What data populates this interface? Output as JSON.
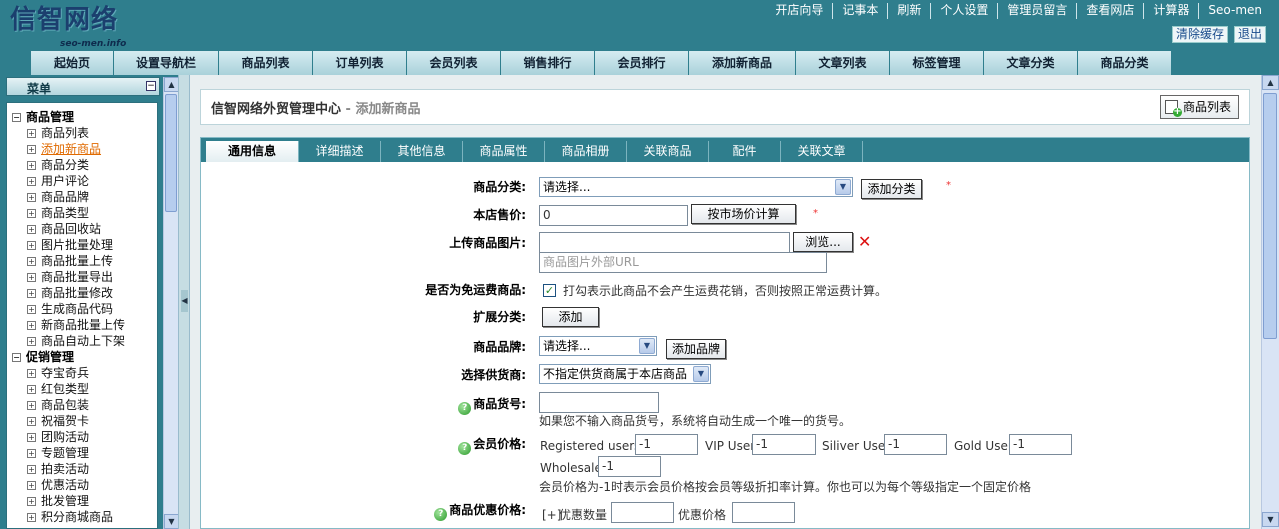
{
  "header": {
    "logo_text": "信智网络",
    "logo_sub": "seo-men.info",
    "top_links": [
      "开店向导",
      "记事本",
      "刷新",
      "个人设置",
      "管理员留言",
      "查看网店",
      "计算器",
      "Seo-men"
    ],
    "clear_cache": "清除缓存",
    "logout": "退出"
  },
  "nav": {
    "tabs": [
      "起始页",
      "设置导航栏",
      "商品列表",
      "订单列表",
      "会员列表",
      "销售排行",
      "会员排行",
      "添加新商品",
      "文章列表",
      "标签管理",
      "文章分类",
      "商品分类"
    ]
  },
  "sidebar": {
    "title": "菜单",
    "group1": "商品管理",
    "items1": [
      "商品列表",
      "添加新商品",
      "商品分类",
      "用户评论",
      "商品品牌",
      "商品类型",
      "商品回收站",
      "图片批量处理",
      "商品批量上传",
      "商品批量导出",
      "商品批量修改",
      "生成商品代码",
      "新商品批量上传",
      "商品自动上下架"
    ],
    "group2": "促销管理",
    "items2": [
      "夺宝奇兵",
      "红包类型",
      "商品包装",
      "祝福贺卡",
      "团购活动",
      "专题管理",
      "拍卖活动",
      "优惠活动",
      "批发管理",
      "积分商城商品"
    ]
  },
  "main": {
    "title": "信智网络外贸管理中心",
    "subtitle": " - 添加新商品",
    "list_button": "商品列表",
    "tabs": [
      "通用信息",
      "详细描述",
      "其他信息",
      "商品属性",
      "商品相册",
      "关联商品",
      "配件",
      "关联文章"
    ]
  },
  "form": {
    "category_label": "商品分类:",
    "category_value": "请选择...",
    "add_category": "添加分类",
    "price_label": "本店售价:",
    "price_value": "0",
    "market_calc": "按市场价计算",
    "image_label": "上传商品图片:",
    "browse": "浏览...",
    "image_url_placeholder": "商品图片外部URL",
    "free_ship_label": "是否为免运费商品:",
    "free_ship_text": "打勾表示此商品不会产生运费花销，否则按照正常运费计算。",
    "ext_category_label": "扩展分类:",
    "add": "添加",
    "brand_label": "商品品牌:",
    "brand_value": "请选择...",
    "add_brand": "添加品牌",
    "supplier_label": "选择供货商:",
    "supplier_value": "不指定供货商属于本店商品",
    "sn_label": "商品货号:",
    "sn_hint": "如果您不输入商品货号，系统将自动生成一个唯一的货号。",
    "member_price_label": "会员价格:",
    "member_levels": [
      {
        "name": "Registered users",
        "value": "-1"
      },
      {
        "name": "VIP User",
        "value": "-1"
      },
      {
        "name": "Siliver User",
        "value": "-1"
      },
      {
        "name": "Gold User",
        "value": "-1"
      }
    ],
    "wholesale_label": "Wholesale",
    "wholesale_value": "-1",
    "member_price_hint": "会员价格为-1时表示会员价格按会员等级折扣率计算。你也可以为每个等级指定一个固定价格",
    "promo_label": "商品优惠价格:",
    "promo_plus": "[+]",
    "promo_qty": "优惠数量",
    "promo_price": "优惠价格",
    "required_mark": "*"
  }
}
